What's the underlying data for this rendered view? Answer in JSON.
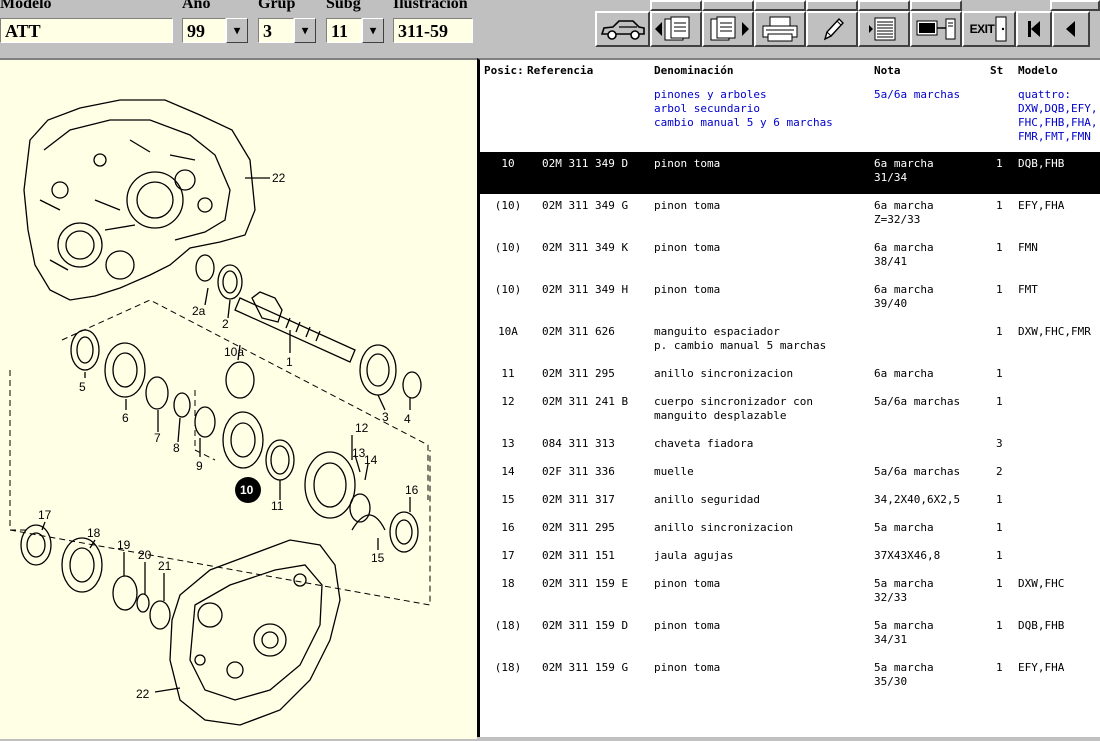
{
  "header": {
    "labels": {
      "modelo": "Modelo",
      "anio": "Año",
      "grup": "Grup",
      "subg": "Subg",
      "ilustracion": "Ilustración"
    },
    "values": {
      "modelo": "ATT",
      "anio": "99",
      "grup": "3",
      "subg": "11",
      "ilustracion": "311-59"
    },
    "toolbar": {
      "exit_label": "EXIT"
    }
  },
  "diagram": {
    "callouts": [
      "22",
      "2a",
      "2",
      "1",
      "10a",
      "5",
      "6",
      "7",
      "8",
      "9",
      "3",
      "4",
      "12",
      "13",
      "14",
      "10",
      "11",
      "16",
      "17",
      "18",
      "19",
      "20",
      "21",
      "15",
      "22"
    ]
  },
  "table": {
    "columns": {
      "posic": "Posic:",
      "referencia": "Referencia",
      "denominacion": "Denominación",
      "nota": "Nota",
      "st": "St",
      "modelo": "Modelo"
    },
    "info": {
      "denominacion": "pinones y arboles\narbol secundario\ncambio manual 5 y 6 marchas",
      "nota": "5a/6a marchas",
      "modelo": "quattro:\nDXW,DQB,EFY,\nFHC,FHB,FHA,\nFMR,FMT,FMN"
    },
    "rows": [
      {
        "posic": "10",
        "ref": "02M 311 349 D",
        "den": "pinon toma",
        "nota": "6a marcha\n31/34",
        "st": "1",
        "modelo": "DQB,FHB",
        "selected": true
      },
      {
        "posic": "(10)",
        "ref": "02M 311 349 G",
        "den": "pinon toma",
        "nota": "6a marcha\nZ=32/33",
        "st": "1",
        "modelo": "EFY,FHA"
      },
      {
        "posic": "(10)",
        "ref": "02M 311 349 K",
        "den": "pinon toma",
        "nota": "6a marcha\n38/41",
        "st": "1",
        "modelo": "FMN"
      },
      {
        "posic": "(10)",
        "ref": "02M 311 349 H",
        "den": "pinon toma",
        "nota": "6a marcha\n39/40",
        "st": "1",
        "modelo": "FMT"
      },
      {
        "posic": "10A",
        "ref": "02M 311 626",
        "den": "manguito espaciador\np. cambio manual 5 marchas",
        "nota": "",
        "st": "1",
        "modelo": "DXW,FHC,FMR"
      },
      {
        "posic": "11",
        "ref": "02M 311 295",
        "den": "anillo sincronizacion",
        "nota": "6a marcha",
        "st": "1",
        "modelo": ""
      },
      {
        "posic": "12",
        "ref": "02M 311 241 B",
        "den": "cuerpo sincronizador con\nmanguito desplazable",
        "nota": "5a/6a marchas",
        "st": "1",
        "modelo": ""
      },
      {
        "posic": "13",
        "ref": "084 311 313",
        "den": "chaveta fiadora",
        "nota": "",
        "st": "3",
        "modelo": ""
      },
      {
        "posic": "14",
        "ref": "02F 311 336",
        "den": "muelle",
        "nota": "5a/6a marchas",
        "st": "2",
        "modelo": ""
      },
      {
        "posic": "15",
        "ref": "02M 311 317",
        "den": "anillo seguridad",
        "nota": "34,2X40,6X2,5",
        "st": "1",
        "modelo": ""
      },
      {
        "posic": "16",
        "ref": "02M 311 295",
        "den": "anillo sincronizacion",
        "nota": "5a marcha",
        "st": "1",
        "modelo": ""
      },
      {
        "posic": "17",
        "ref": "02M 311 151",
        "den": "jaula agujas",
        "nota": "37X43X46,8",
        "st": "1",
        "modelo": ""
      },
      {
        "posic": "18",
        "ref": "02M 311 159 E",
        "den": "pinon toma",
        "nota": "5a marcha\n32/33",
        "st": "1",
        "modelo": "DXW,FHC"
      },
      {
        "posic": "(18)",
        "ref": "02M 311 159 D",
        "den": "pinon toma",
        "nota": "5a marcha\n34/31",
        "st": "1",
        "modelo": "DQB,FHB"
      },
      {
        "posic": "(18)",
        "ref": "02M 311 159 G",
        "den": "pinon toma",
        "nota": "5a marcha\n35/30",
        "st": "1",
        "modelo": "EFY,FHA"
      }
    ]
  }
}
